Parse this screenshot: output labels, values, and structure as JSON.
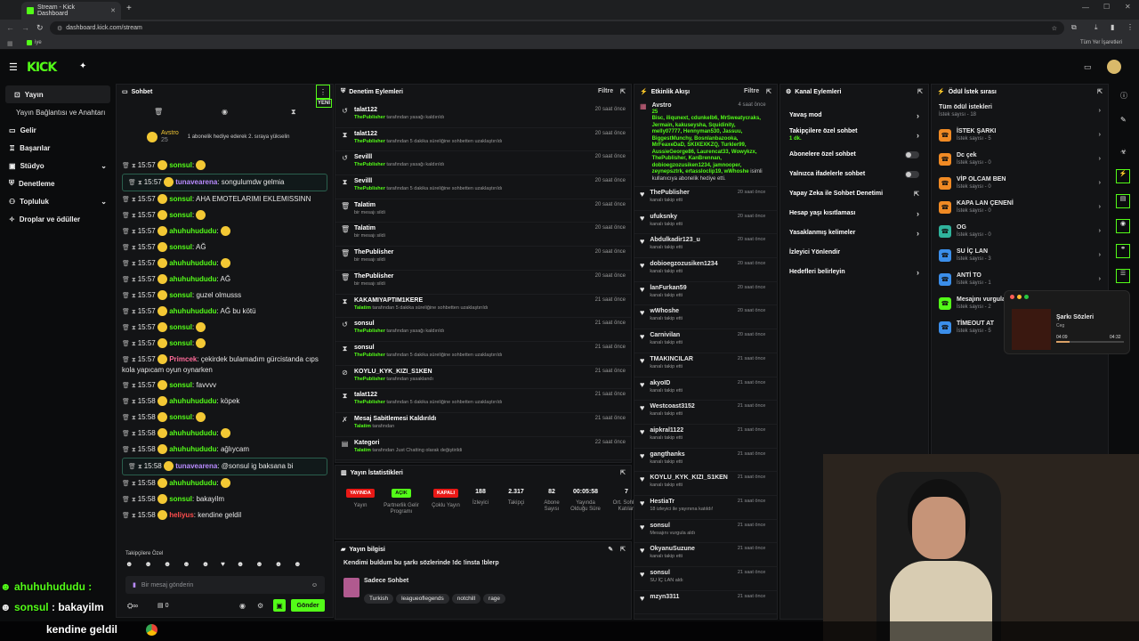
{
  "browser": {
    "tab_title": "Stream - Kick Dashboard",
    "new_tab": "+",
    "url": "dashboard.kick.com/stream",
    "bookmark": "iye",
    "all_bookmarks": "Tüm Yer İşaretleri"
  },
  "app": {
    "logo": "KICK"
  },
  "sidebar": {
    "items": [
      {
        "label": "Yayın"
      },
      {
        "label": "Yayın Bağlantısı ve Anahtarı"
      },
      {
        "label": "Gelir"
      },
      {
        "label": "Başarılar"
      },
      {
        "label": "Stüdyo"
      },
      {
        "label": "Denetleme"
      },
      {
        "label": "Topluluk"
      },
      {
        "label": "Droplar ve ödüller"
      }
    ]
  },
  "chat": {
    "title": "Sohbet",
    "new_label": "YENİ",
    "gifter_name": "Avstro",
    "gifter_count": "25",
    "gift_text": "1 abonelik hediye ederek 2. sıraya yükselin",
    "messages": [
      {
        "time": "15:57",
        "user": "sonsul",
        "text": "",
        "color": "#53fc18"
      },
      {
        "time": "15:57",
        "user": "tunavearena",
        "text": "songulumdw gelmia",
        "color": "#b98bff"
      },
      {
        "time": "15:57",
        "user": "sonsul",
        "text": "AHA EMOTELARIMI EKLEMISSINN",
        "color": "#53fc18"
      },
      {
        "time": "15:57",
        "user": "sonsul",
        "text": "",
        "color": "#53fc18"
      },
      {
        "time": "15:57",
        "user": "ahuhuhududu",
        "text": "",
        "color": "#53fc18"
      },
      {
        "time": "15:57",
        "user": "sonsul",
        "text": "AĞ",
        "color": "#53fc18"
      },
      {
        "time": "15:57",
        "user": "ahuhuhududu",
        "text": "",
        "color": "#53fc18"
      },
      {
        "time": "15:57",
        "user": "ahuhuhududu",
        "text": "AĞ",
        "color": "#53fc18"
      },
      {
        "time": "15:57",
        "user": "sonsul",
        "text": "guzel olmusss",
        "color": "#53fc18"
      },
      {
        "time": "15:57",
        "user": "ahuhuhududu",
        "text": "AĞ bu kötü",
        "color": "#53fc18"
      },
      {
        "time": "15:57",
        "user": "sonsul",
        "text": "",
        "color": "#53fc18"
      },
      {
        "time": "15:57",
        "user": "sonsul",
        "text": "",
        "color": "#53fc18"
      },
      {
        "time": "15:57",
        "user": "Primcek",
        "text": "çekirdek bulamadım gürcistanda cıps kola yapıcam oyun oynarken",
        "color": "#ff6b9a"
      },
      {
        "time": "15:57",
        "user": "sonsul",
        "text": "favvvv",
        "color": "#53fc18"
      },
      {
        "time": "15:58",
        "user": "ahuhuhududu",
        "text": "köpek",
        "color": "#53fc18"
      },
      {
        "time": "15:58",
        "user": "sonsul",
        "text": "",
        "color": "#53fc18"
      },
      {
        "time": "15:58",
        "user": "ahuhuhududu",
        "text": "",
        "color": "#53fc18"
      },
      {
        "time": "15:58",
        "user": "ahuhuhududu",
        "text": "ağlıycam",
        "color": "#53fc18"
      },
      {
        "time": "15:58",
        "user": "tunavearena",
        "text": "@sonsul ig baksana bi",
        "color": "#b98bff"
      },
      {
        "time": "15:58",
        "user": "ahuhuhududu",
        "text": "",
        "color": "#53fc18"
      },
      {
        "time": "15:58",
        "user": "sonsul",
        "text": "bakayilm",
        "color": "#53fc18"
      },
      {
        "time": "15:58",
        "user": "heliyus",
        "text": "kendine geldil",
        "color": "#ff4d4d"
      }
    ],
    "followers_label": "Takipçilere Özel",
    "input_placeholder": "Bir mesaj gönderin",
    "viewer_count": "0",
    "send_label": "Gönder"
  },
  "moderation": {
    "title": "Denetim Eylemleri",
    "filter": "Filtre",
    "rows": [
      {
        "icon": "↺",
        "name": "talat122",
        "actor": "ThePublisher",
        "desc": "tarafından yasağı kaldırıldı",
        "time": "20 saat önce"
      },
      {
        "icon": "⧗",
        "name": "talat122",
        "actor": "ThePublisher",
        "desc": "tarafından 5 dakika süreliğine sohbetten uzaklaştırıldı",
        "time": "20 saat önce"
      },
      {
        "icon": "↺",
        "name": "Sevilll",
        "actor": "ThePublisher",
        "desc": "tarafından yasağı kaldırıldı",
        "time": "20 saat önce"
      },
      {
        "icon": "⧗",
        "name": "Sevilll",
        "actor": "ThePublisher",
        "desc": "tarafından 5 dakika süreliğine sohbetten uzaklaştırıldı",
        "time": "20 saat önce"
      },
      {
        "icon": "🗑",
        "name": "Talatim",
        "actor": "",
        "desc": "bir mesajı sildi",
        "time": "20 saat önce"
      },
      {
        "icon": "🗑",
        "name": "Talatim",
        "actor": "",
        "desc": "bir mesajı sildi",
        "time": "20 saat önce"
      },
      {
        "icon": "🗑",
        "name": "ThePublisher",
        "actor": "",
        "desc": "bir mesajı sildi",
        "time": "20 saat önce"
      },
      {
        "icon": "🗑",
        "name": "ThePublisher",
        "actor": "",
        "desc": "bir mesajı sildi",
        "time": "20 saat önce"
      },
      {
        "icon": "⧗",
        "name": "KAKAMIYAPTIM1KERE",
        "actor": "Talatim",
        "desc": "tarafından 5 dakika süreliğine sohbetten uzaklaştırıldı",
        "time": "21 saat önce"
      },
      {
        "icon": "↺",
        "name": "sonsul",
        "actor": "ThePublisher",
        "desc": "tarafından yasağı kaldırıldı",
        "time": "21 saat önce"
      },
      {
        "icon": "⧗",
        "name": "sonsul",
        "actor": "ThePublisher",
        "desc": "tarafından 5 dakika süreliğine sohbetten uzaklaştırıldı",
        "time": "21 saat önce"
      },
      {
        "icon": "⊘",
        "name": "KOYLU_KYK_KIZI_S1KEN",
        "actor": "ThePublisher",
        "desc": "tarafından yasaklandı",
        "time": "21 saat önce"
      },
      {
        "icon": "⧗",
        "name": "talat122",
        "actor": "ThePublisher",
        "desc": "tarafından 5 dakika süreliğine sohbetten uzaklaştırıldı",
        "time": "21 saat önce"
      },
      {
        "icon": "✗",
        "name": "Mesaj Sabitlemesi Kaldırıldı",
        "actor": "Talatim",
        "desc": "tarafından",
        "time": "21 saat önce"
      },
      {
        "icon": "▤",
        "name": "Kategori",
        "actor": "Talatim",
        "desc": "tarafından Just Chatting olarak değiştirildi",
        "time": "22 saat önce"
      }
    ]
  },
  "activity": {
    "title": "Etkinlik Akışı",
    "filter": "Filtre",
    "gift": {
      "name": "Avstro",
      "time": "4 saat önce",
      "count": "25",
      "names": "Bisc, iliqunext, cdunkelb6, MrSweatycraks, Jermain, kakuseysha, Squidinity, melly07777, Hennyman530, Jassuu, BiggestMunchy, Bosnlanbazooka, MrFeaxeDaD, SKIXEXKZQ, Turkler99, AussieGeorge86, Laurencat33, Wowykzx, ThePublisher, KanBrennan, dobioegzozusiken1234, jamnooper, zeynepsztrk, ertassloclip19, wWhoshe",
      "suffix": "isimli kullanıcıya abonelik hediye etti."
    },
    "rows": [
      {
        "name": "ThePublisher",
        "desc": "kanalı takip etti",
        "time": "20 saat önce"
      },
      {
        "name": "ufuksnky",
        "desc": "kanalı takip etti",
        "time": "20 saat önce"
      },
      {
        "name": "Abdulkadir123_u",
        "desc": "kanalı takip etti",
        "time": "20 saat önce"
      },
      {
        "name": "dobioegzozusiken1234",
        "desc": "kanalı takip etti",
        "time": "20 saat önce"
      },
      {
        "name": "lanFurkan59",
        "desc": "kanalı takip etti",
        "time": "20 saat önce"
      },
      {
        "name": "wWhoshe",
        "desc": "kanalı takip etti",
        "time": "20 saat önce"
      },
      {
        "name": "Carnivilan",
        "desc": "kanalı takip etti",
        "time": "20 saat önce"
      },
      {
        "name": "TMAKINCILAR",
        "desc": "kanalı takip etti",
        "time": "21 saat önce"
      },
      {
        "name": "akyoID",
        "desc": "kanalı takip etti",
        "time": "21 saat önce"
      },
      {
        "name": "Westcoast3152",
        "desc": "kanalı takip etti",
        "time": "21 saat önce"
      },
      {
        "name": "aipkral1122",
        "desc": "kanalı takip etti",
        "time": "21 saat önce"
      },
      {
        "name": "gangthanks",
        "desc": "kanalı takip etti",
        "time": "21 saat önce"
      },
      {
        "name": "KOYLU_KYK_KIZI_S1KEN",
        "desc": "kanalı takip etti",
        "time": "21 saat önce"
      },
      {
        "name": "HestiaTr",
        "desc": "18 izleyici ile yayınına katıldı!",
        "time": "21 saat önce"
      },
      {
        "name": "sonsul",
        "desc": "Mesajını vurgula aldı",
        "time": "21 saat önce"
      },
      {
        "name": "OkyanuSuzune",
        "desc": "kanalı takip etti",
        "time": "21 saat önce"
      },
      {
        "name": "sonsul",
        "desc": "SU İÇ LAN aldı",
        "time": "21 saat önce"
      },
      {
        "name": "mzyn3311",
        "desc": "",
        "time": "21 saat önce"
      }
    ]
  },
  "channel": {
    "title": "Kanal Eylemleri",
    "rows": [
      {
        "label": "Yavaş mod",
        "sub": "",
        "kind": "chev"
      },
      {
        "label": "Takipçilere özel sohbet",
        "sub": "1 dk.",
        "kind": "chev"
      },
      {
        "label": "Abonelere özel sohbet",
        "sub": "",
        "kind": "toggle"
      },
      {
        "label": "Yalnızca ifadelerle sohbet",
        "sub": "",
        "kind": "toggle"
      },
      {
        "label": "Yapay Zeka ile Sohbet Denetimi",
        "sub": "",
        "kind": "ext"
      },
      {
        "label": "Hesap yaşı kısıtlaması",
        "sub": "",
        "kind": "chev"
      },
      {
        "label": "Yasaklanmış kelimeler",
        "sub": "",
        "kind": "chev"
      },
      {
        "label": "İzleyici Yönlendir",
        "sub": "",
        "kind": "none"
      },
      {
        "label": "Hedefleri belirleyin",
        "sub": "",
        "kind": "chev"
      }
    ]
  },
  "rewards": {
    "title": "Ödül İstek sırası",
    "all_label": "Tüm ödül istekleri",
    "all_sub": "İstek sayısı - 18",
    "rows": [
      {
        "name": "İSTEK ŞARKI",
        "sub": "İstek sayısı - 5",
        "color": "#f08a24"
      },
      {
        "name": "Dc çek",
        "sub": "İstek sayısı - 0",
        "color": "#f08a24"
      },
      {
        "name": "VİP OLCAM BEN",
        "sub": "İstek sayısı - 0",
        "color": "#f08a24"
      },
      {
        "name": "KAPA LAN ÇENENİ",
        "sub": "İstek sayısı - 0",
        "color": "#f08a24"
      },
      {
        "name": "OG",
        "sub": "İstek sayısı - 0",
        "color": "#2fb39c"
      },
      {
        "name": "SU İÇ LAN",
        "sub": "İstek sayısı - 3",
        "color": "#3b8eea"
      },
      {
        "name": "ANTİ TO",
        "sub": "İstek sayısı - 1",
        "color": "#3b8eea"
      },
      {
        "name": "Mesajını vurgula",
        "sub": "İstek sayısı - 2",
        "color": "#53fc18"
      },
      {
        "name": "TİMEOUT AT",
        "sub": "İstek sayısı - 5",
        "color": "#3b8eea"
      }
    ]
  },
  "stats": {
    "title": "Yayın İstatistikleri",
    "items": [
      {
        "value": "YAYINDA",
        "label": "Yayın"
      },
      {
        "value": "AÇIK",
        "label": "Partnerlik Gelir Programı"
      },
      {
        "value": "KAPALI",
        "label": "Çoklu Yayın"
      },
      {
        "value": "188",
        "label": "İzleyici"
      },
      {
        "value": "2.317",
        "label": "Takipçi"
      },
      {
        "value": "82",
        "label": "Abone Sayısı"
      },
      {
        "value": "00:05:58",
        "label": "Yayında Olduğu Süre"
      },
      {
        "value": "7",
        "label": "Ort. Sohbet Katılan"
      }
    ]
  },
  "info": {
    "title": "Yayın bilgisi",
    "stream_title": "Kendimi buldum bu şarkı sözlerinde !dc !insta !blerp",
    "category": "Sadece Sohbet",
    "tags": [
      "Turkish",
      "leagueoflegends",
      "notchill",
      "rage"
    ]
  },
  "music": {
    "title": "Şarkı Sözleri",
    "artist": "Ceg",
    "elapsed": "04:09",
    "total": "04:32",
    "progress": 0.2
  },
  "overlay": {
    "line1_user": "ahuhuhududu",
    "line2_user": "sonsul",
    "line2_text": "bakayilm",
    "line3_text": "kendine geldil"
  }
}
